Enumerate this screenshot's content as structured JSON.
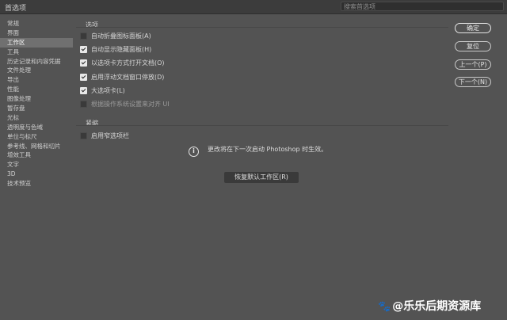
{
  "window": {
    "title": "首选项",
    "search_placeholder": "搜索首选项"
  },
  "sidebar": {
    "items": [
      {
        "label": "常规"
      },
      {
        "label": "界面"
      },
      {
        "label": "工作区",
        "active": true
      },
      {
        "label": "工具"
      },
      {
        "label": "历史记录和内容凭据"
      },
      {
        "label": "文件处理"
      },
      {
        "label": "导出"
      },
      {
        "label": "性能"
      },
      {
        "label": "图像处理"
      },
      {
        "label": "暂存盘"
      },
      {
        "label": "光标"
      },
      {
        "label": "透明度与色域"
      },
      {
        "label": "单位与标尺"
      },
      {
        "label": "参考线、网格和切片"
      },
      {
        "label": "增效工具"
      },
      {
        "label": "文字"
      },
      {
        "label": "3D"
      },
      {
        "label": "技术预览"
      }
    ]
  },
  "options_section": {
    "label": "选项",
    "items": [
      {
        "label": "自动折叠图标面板(A)",
        "checked": false,
        "disabled": false
      },
      {
        "label": "自动显示隐藏面板(H)",
        "checked": true,
        "disabled": false
      },
      {
        "label": "以选项卡方式打开文档(O)",
        "checked": true,
        "disabled": false
      },
      {
        "label": "启用浮动文档窗口停放(D)",
        "checked": true,
        "disabled": false
      },
      {
        "label": "大选项卡(L)",
        "checked": true,
        "disabled": false
      },
      {
        "label": "根据操作系统设置来对齐 UI",
        "checked": false,
        "disabled": true
      }
    ]
  },
  "compact_section": {
    "label": "紧缩",
    "items": [
      {
        "label": "启用窄选项栏",
        "checked": false
      }
    ]
  },
  "info": {
    "message": "更改将在下一次启动 Photoshop 时生效。"
  },
  "reset_button": {
    "label": "恢复默认工作区(R)"
  },
  "actions": {
    "ok": "确定",
    "reset": "复位",
    "prev": "上一个(P)",
    "next": "下一个(N)"
  },
  "watermark": {
    "text": "@乐乐后期资源库"
  },
  "icons": {
    "info": "info-circle-icon",
    "checkbox": "checkbox-icon",
    "watermark": "paw-icon"
  },
  "colors": {
    "background": "#535353",
    "titlebar": "#3c3c3c",
    "active_item": "#707070"
  }
}
